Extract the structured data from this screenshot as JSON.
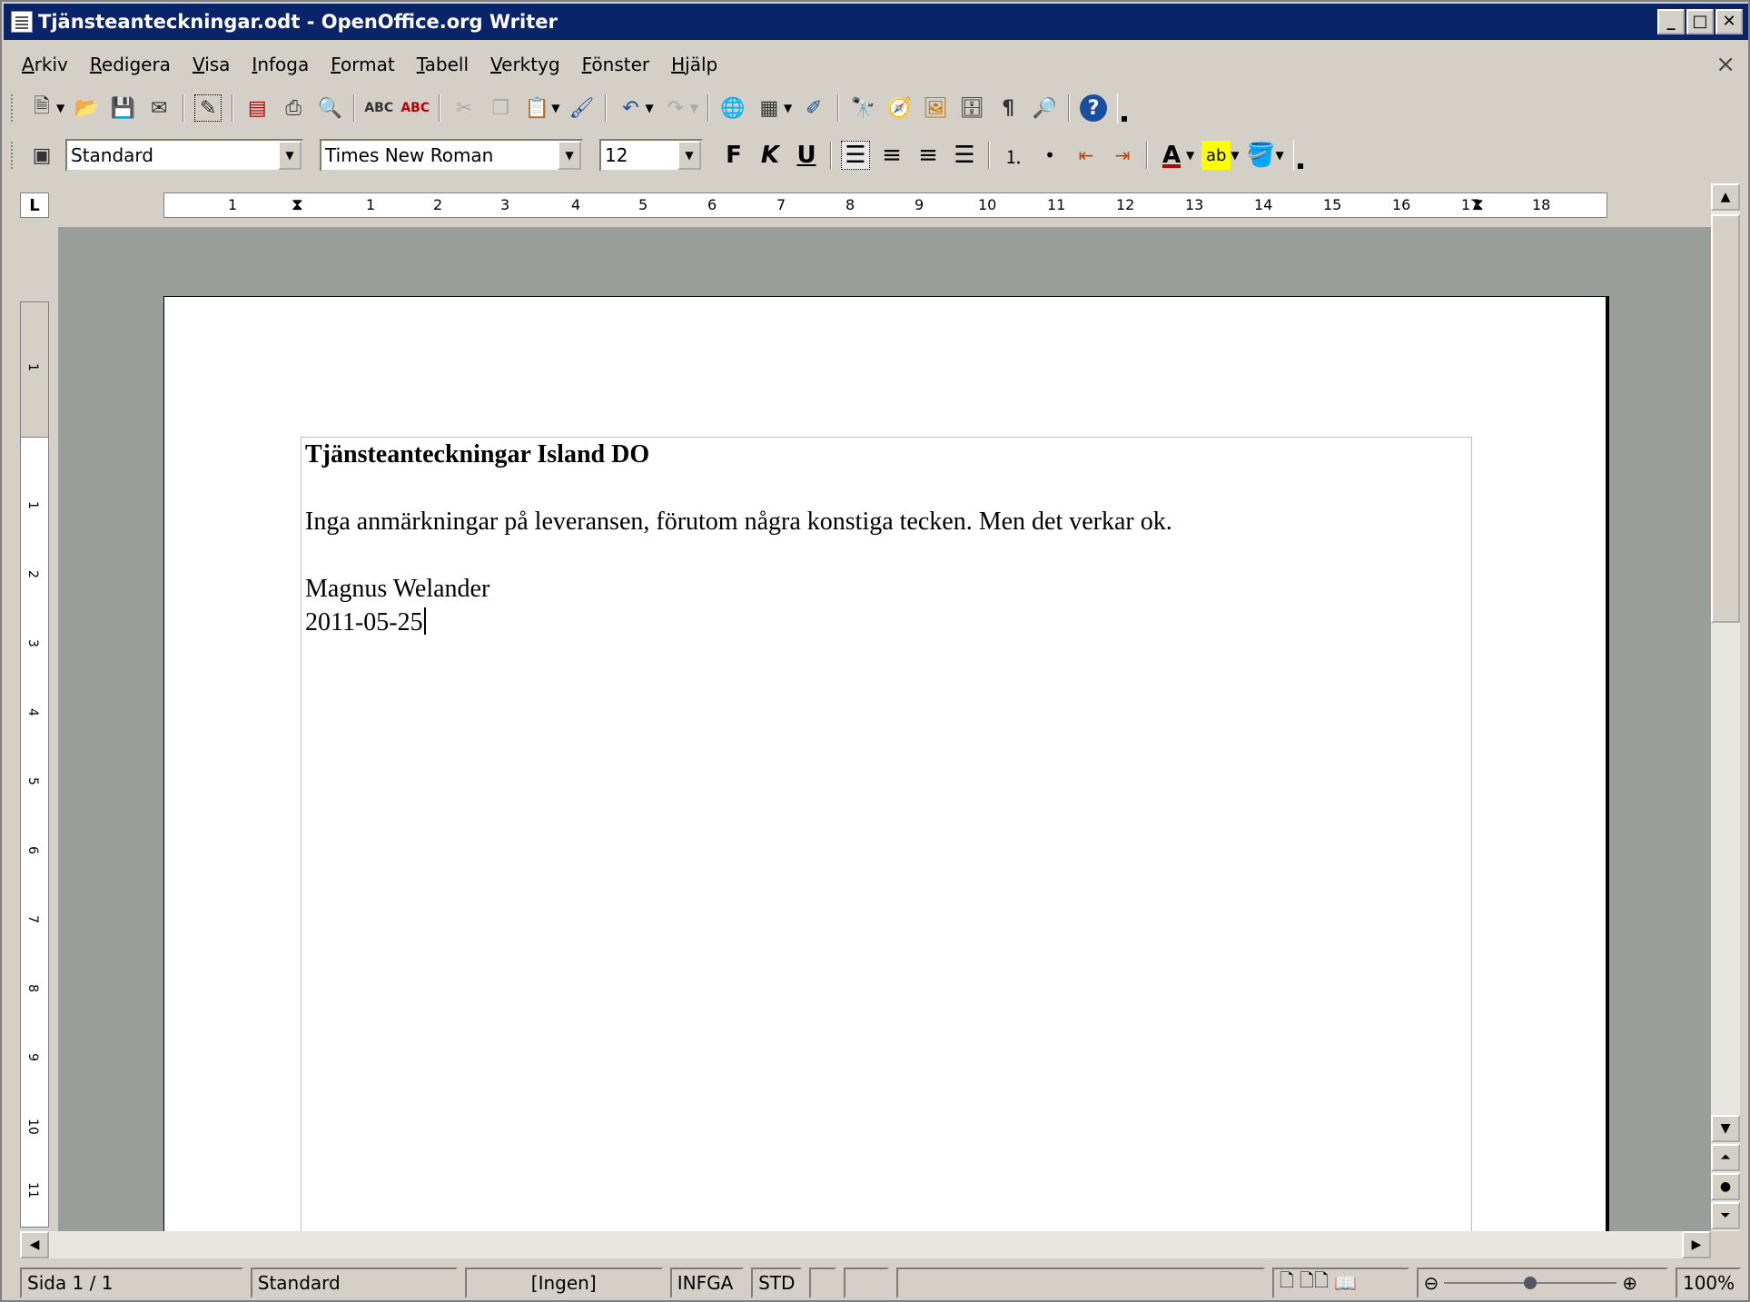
{
  "window": {
    "title": "Tjänsteanteckningar.odt - OpenOffice.org Writer",
    "minimize_label": "_",
    "maximize_label": "□",
    "close_label": "✕"
  },
  "menu": {
    "items": [
      "Arkiv",
      "Redigera",
      "Visa",
      "Infoga",
      "Format",
      "Tabell",
      "Verktyg",
      "Fönster",
      "Hjälp"
    ],
    "doc_close": "×"
  },
  "format_toolbar": {
    "style_value": "Standard",
    "font_value": "Times New Roman",
    "size_value": "12",
    "bold_label": "F",
    "italic_label": "K",
    "underline_label": "U"
  },
  "ruler": {
    "corner": "L",
    "h_ticks": [
      "1",
      "1",
      "2",
      "3",
      "4",
      "5",
      "6",
      "7",
      "8",
      "9",
      "10",
      "11",
      "12",
      "13",
      "14",
      "15",
      "16",
      "17",
      "18"
    ],
    "v_ticks": [
      "1",
      "1",
      "2",
      "3",
      "4",
      "5",
      "6",
      "7",
      "8",
      "9",
      "10",
      "11"
    ]
  },
  "document": {
    "heading": "Tjänsteanteckningar Island DO",
    "body": "Inga anmärkningar på leveransen, förutom några konstiga tecken. Men det verkar ok.",
    "signature_name": "Magnus Welander",
    "signature_date": "2011-05-25"
  },
  "status": {
    "page": "Sida  1 / 1",
    "style": "Standard",
    "language": "[Ingen]",
    "insert_mode": "INFGA",
    "selection_mode": "STD",
    "zoom": "100%",
    "zoom_level_fraction": 0.5
  }
}
